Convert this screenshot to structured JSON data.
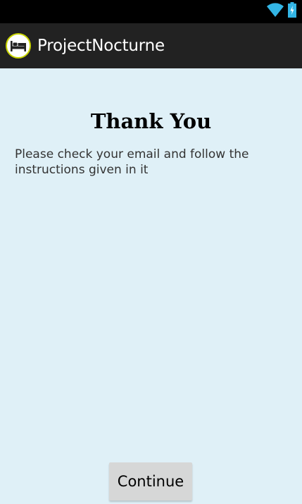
{
  "status_bar": {
    "icons": [
      "wifi-icon",
      "battery-charging-icon"
    ],
    "accent_color": "#33b5e5"
  },
  "action_bar": {
    "app_icon": "bed-icon",
    "title": "ProjectNocturne"
  },
  "main": {
    "heading": "Thank You",
    "message": "Please check your email and follow the instructions given in it",
    "continue_label": "Continue"
  },
  "colors": {
    "background": "#dff0f7",
    "action_bar": "#222222",
    "status_bar": "#000000",
    "button": "#d6d7d7"
  }
}
